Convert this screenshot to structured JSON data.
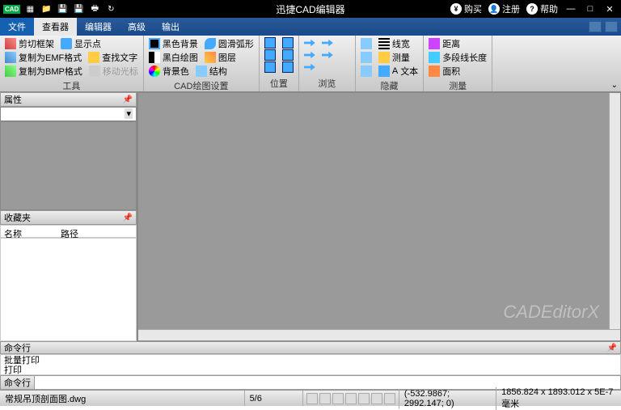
{
  "titlebar": {
    "app_logo": "CAD",
    "title": "迅捷CAD编辑器",
    "buy": "购买",
    "register": "注册",
    "help": "帮助"
  },
  "menu": {
    "file": "文件",
    "viewer": "查看器",
    "editor": "编辑器",
    "advanced": "高级",
    "output": "输出"
  },
  "ribbon": {
    "tools": {
      "label": "工具",
      "crop_frame": "剪切框架",
      "copy_emf": "复制为EMF格式",
      "copy_bmp": "复制为BMP格式",
      "show_point": "显示点",
      "find_text": "查找文字",
      "move_cursor": "移动光标"
    },
    "cad_settings": {
      "label": "CAD绘图设置",
      "black_bg": "黑色背景",
      "bw_draw": "黑白绘图",
      "bg_color": "背景色",
      "smooth_arc": "圆滑弧形",
      "layers": "图层",
      "structure": "结构"
    },
    "position": {
      "label": "位置"
    },
    "browse": {
      "label": "浏览"
    },
    "hide": {
      "label": "隐藏",
      "line_width": "线宽",
      "measure": "测量",
      "text": "文本"
    },
    "measure": {
      "label": "测量",
      "distance": "距离",
      "polyline": "多段线长度",
      "area": "面积"
    }
  },
  "panels": {
    "properties": "属性",
    "favorites": "收藏夹",
    "name_col": "名称",
    "path_col": "路径"
  },
  "canvas": {
    "watermark": "CADEditorX"
  },
  "cmdline": {
    "header": "命令行",
    "history1": "批量打印",
    "history2": "打印",
    "prompt": "命令行"
  },
  "statusbar": {
    "filename": "常规吊顶剖面图.dwg",
    "page": "5/6",
    "coords": "(-532.9867; 2992.147; 0)",
    "dimensions": "1856.824 x 1893.012 x 5E-7毫米"
  }
}
